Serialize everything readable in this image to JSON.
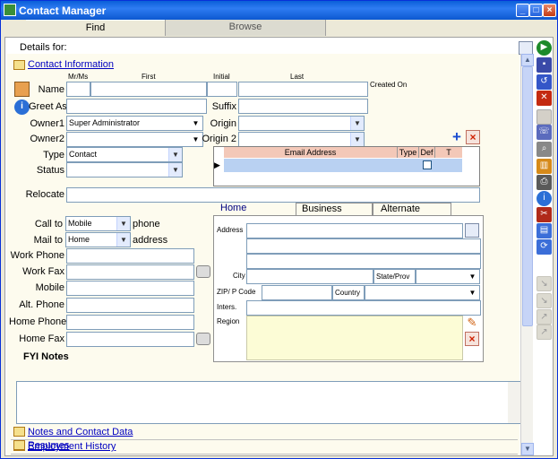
{
  "window": {
    "title": "Contact Manager"
  },
  "tabs": {
    "find": "Find",
    "browse": "Browse"
  },
  "header": {
    "details_for": "Details for:"
  },
  "sections": {
    "contact_info": "Contact Information",
    "notes_data": "Notes and Contact Data",
    "employment": "Employment History",
    "resumes": "Resumes"
  },
  "name_headers": {
    "mrms": "Mr/Ms",
    "first": "First",
    "initial": "Initial",
    "last": "Last",
    "created_on": "Created On"
  },
  "labels": {
    "name": "Name",
    "greet_as": "Greet As",
    "suffix": "Suffix",
    "owner1": "Owner1",
    "owner2": "Owner2",
    "origin": "Origin",
    "origin2": "Origin 2",
    "type": "Type",
    "status": "Status",
    "relocate": "Relocate",
    "call_to": "Call to",
    "phone": "phone",
    "mail_to": "Mail to",
    "address_word": "address",
    "work_phone": "Work Phone",
    "work_fax": "Work Fax",
    "mobile": "Mobile",
    "alt_phone": "Alt. Phone",
    "home_phone": "Home Phone",
    "home_fax": "Home Fax",
    "fyi_notes": "FYI Notes"
  },
  "values": {
    "owner1": "Super Administrator",
    "type": "Contact",
    "call_to": "Mobile",
    "mail_to": "Home"
  },
  "email_grid": {
    "headers": {
      "email": "Email Address",
      "type": "Type",
      "def": "Def",
      "t": "T"
    }
  },
  "address_tabs": [
    "Home",
    "Business",
    "Alternate"
  ],
  "address_labels": {
    "address": "Address",
    "city": "City",
    "state": "State/Prov",
    "zip": "ZIP/ P Code",
    "country": "Country",
    "inters": "Inters.",
    "region": "Region"
  }
}
